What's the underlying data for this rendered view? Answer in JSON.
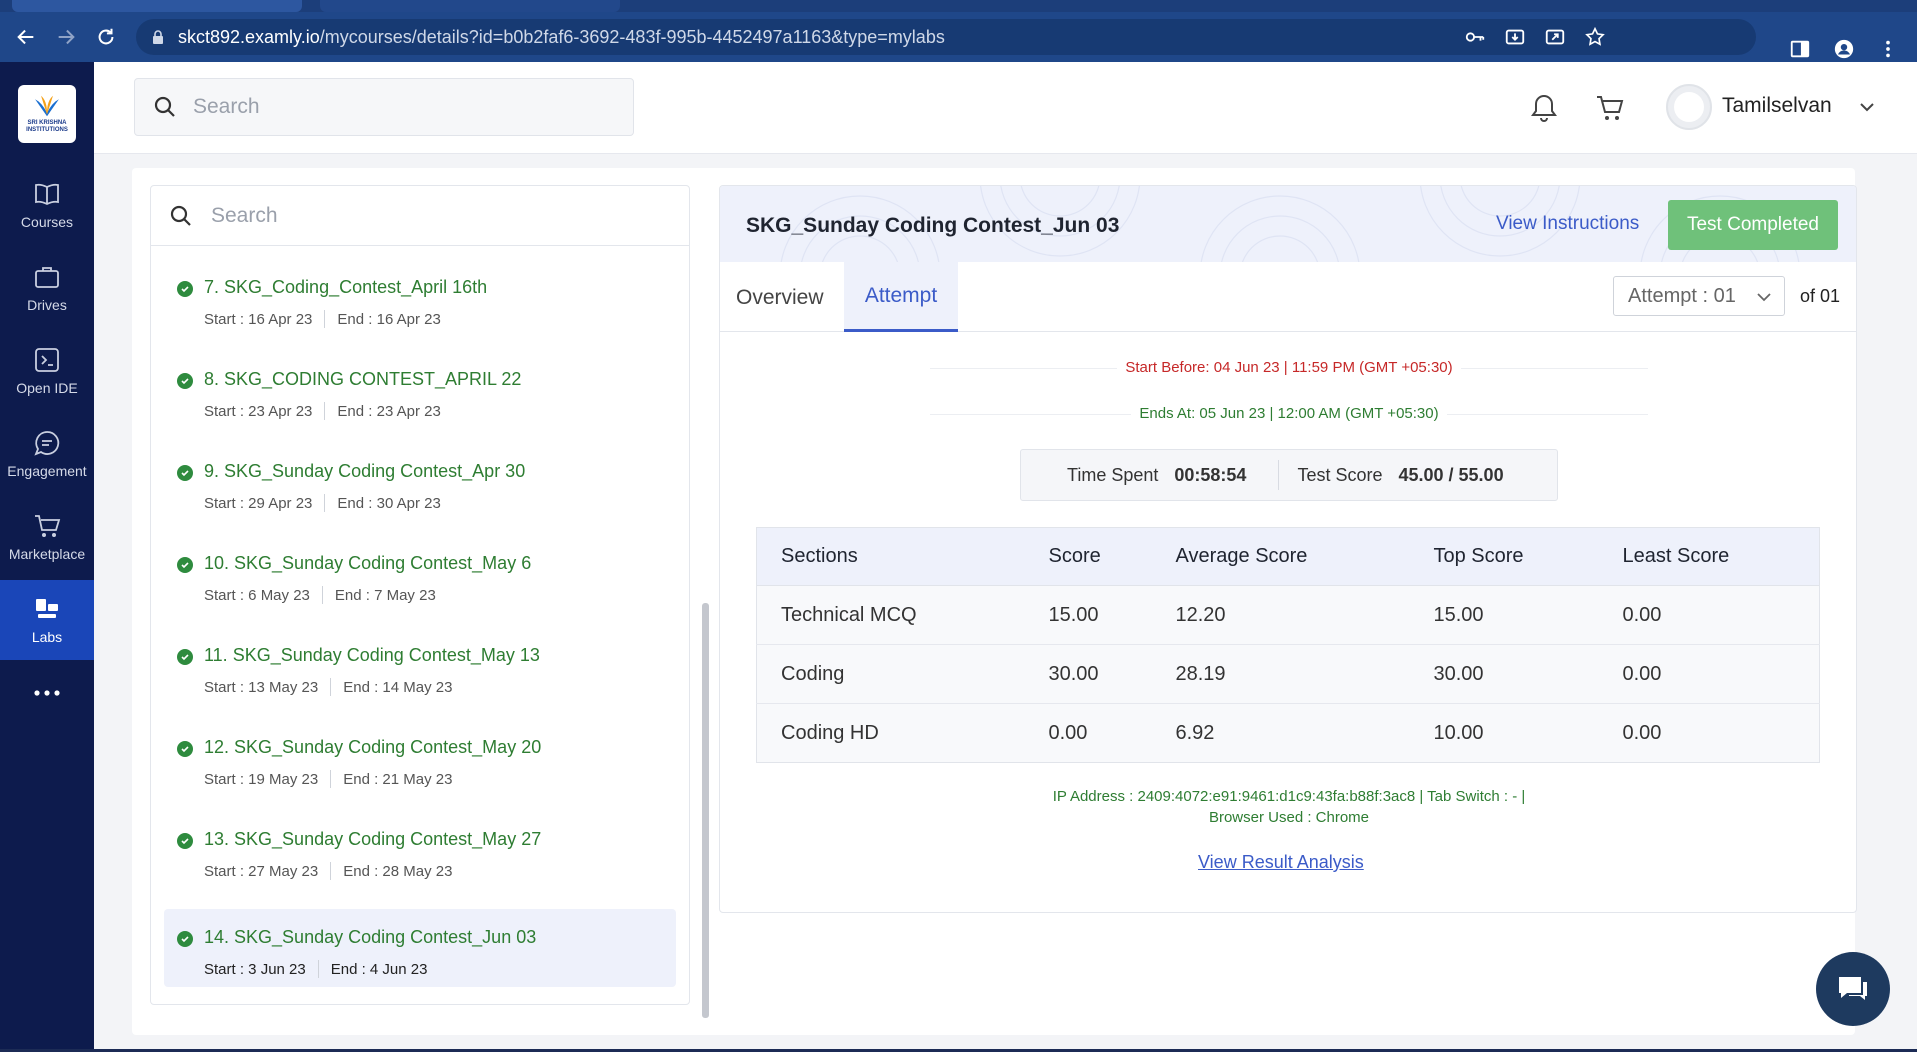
{
  "browser": {
    "url_host": "skct892.examly.io",
    "url_path": "/mycourses/details?id=b0b2faf6-3692-483f-995b-4452497a1163&type=mylabs"
  },
  "rail": {
    "logo_text": "SRI KRISHNA INSTITUTIONS",
    "items": [
      {
        "label": "Courses",
        "icon": "book-icon"
      },
      {
        "label": "Drives",
        "icon": "briefcase-icon"
      },
      {
        "label": "Open IDE",
        "icon": "terminal-icon"
      },
      {
        "label": "Engagement",
        "icon": "chat-bubble-icon"
      },
      {
        "label": "Marketplace",
        "icon": "cart-icon"
      },
      {
        "label": "Labs",
        "icon": "labs-icon",
        "active": true
      }
    ],
    "more_icon": "more-dots-icon"
  },
  "header": {
    "search_placeholder": "Search",
    "username": "Tamilselvan"
  },
  "list": {
    "search_placeholder": "Search",
    "items": [
      {
        "title": "7. SKG_Coding_Contest_April 16th",
        "start": "Start : 16 Apr 23",
        "end": "End : 16 Apr 23"
      },
      {
        "title": "8. SKG_CODING CONTEST_APRIL 22",
        "start": "Start : 23 Apr 23",
        "end": "End : 23 Apr 23"
      },
      {
        "title": "9. SKG_Sunday Coding Contest_Apr 30",
        "start": "Start : 29 Apr 23",
        "end": "End : 30 Apr 23"
      },
      {
        "title": "10. SKG_Sunday Coding Contest_May 6",
        "start": "Start : 6 May 23",
        "end": "End : 7 May 23"
      },
      {
        "title": "11. SKG_Sunday Coding Contest_May 13",
        "start": "Start : 13 May 23",
        "end": "End : 14 May 23"
      },
      {
        "title": "12. SKG_Sunday Coding Contest_May 20",
        "start": "Start : 19 May 23",
        "end": "End : 21 May 23"
      },
      {
        "title": "13. SKG_Sunday Coding Contest_May 27",
        "start": "Start : 27 May 23",
        "end": "End : 28 May 23"
      },
      {
        "title": "14. SKG_Sunday Coding Contest_Jun 03",
        "start": "Start : 3 Jun 23",
        "end": "End : 4 Jun 23",
        "selected": true
      }
    ]
  },
  "detail": {
    "title": "SKG_Sunday Coding Contest_Jun 03",
    "view_instructions": "View Instructions",
    "status_button": "Test Completed",
    "tabs": {
      "overview": "Overview",
      "attempt": "Attempt"
    },
    "attempt_select": "Attempt : 01",
    "of_count": "of 01",
    "start_before": "Start Before: 04 Jun 23 | 11:59 PM (GMT +05:30)",
    "ends_at": "Ends At: 05 Jun 23 | 12:00 AM (GMT +05:30)",
    "time_spent_label": "Time Spent",
    "time_spent_value": "00:58:54",
    "test_score_label": "Test Score",
    "test_score_value": "45.00 / 55.00",
    "table": {
      "headers": [
        "Sections",
        "Score",
        "Average Score",
        "Top Score",
        "Least Score"
      ],
      "rows": [
        [
          "Technical MCQ",
          "15.00",
          "12.20",
          "15.00",
          "0.00"
        ],
        [
          "Coding",
          "30.00",
          "28.19",
          "30.00",
          "0.00"
        ],
        [
          "Coding HD",
          "0.00",
          "6.92",
          "10.00",
          "0.00"
        ]
      ]
    },
    "ip_line_1": "IP Address : 2409:4072:e91:9461:d1c9:43fa:b88f:3ac8 | Tab Switch : - |",
    "ip_line_2": "Browser Used : Chrome",
    "result_link": "View Result Analysis"
  },
  "colors": {
    "rail_bg": "#0d1b4d",
    "rail_active": "#1a46b8",
    "accent": "#3b5bc8",
    "success": "#2e7d32",
    "danger": "#c62828",
    "completed_btn": "#6fc17a"
  }
}
